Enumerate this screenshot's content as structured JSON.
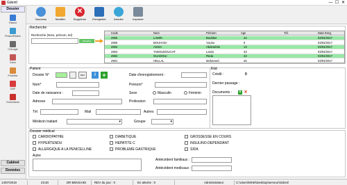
{
  "window": {
    "title": "Gdentl",
    "controls": [
      "—",
      "☐",
      "✕"
    ]
  },
  "sidebar": {
    "top_button": "Dossier",
    "items": [
      "Patient",
      "Photos/Radios",
      "Chirurgie",
      "Soins",
      "Prothèse",
      "ODF",
      "Ordonnance"
    ],
    "bottom_buttons": [
      "Cabinet",
      "Données"
    ]
  },
  "toolbar": {
    "buttons": [
      "Nouveau",
      "Modifier",
      "Supprimer",
      "Enregistrer",
      "Annuler",
      "Imprimer"
    ]
  },
  "search": {
    "section_title": "Recherche",
    "label": "Recherche (Nom, prénom, tel)",
    "value": "",
    "hint": "[illegible]",
    "table": {
      "columns": [
        "Code",
        "Nom",
        "Prénom",
        "Age",
        "Tél.",
        "Date Enrg."
      ],
      "rows": [
        [
          "2906",
          "LAMRI",
          "Boubker",
          "44",
          "",
          "03/04/2017"
        ],
        [
          "2905",
          "BOUHADI",
          "Yacine",
          "8",
          "",
          "03/04/2017"
        ],
        [
          "2904",
          "AISSA",
          "Abderahim",
          "13",
          "",
          "03/04/2017"
        ],
        [
          "2903",
          "TABOUDOUCHT",
          "Lamia",
          "33",
          "",
          "03/04/2017"
        ],
        [
          "2902",
          "GUADOUI",
          "Reda",
          "43",
          "",
          "03/04/2017"
        ],
        [
          "2901",
          "HELLAL",
          "Mohamed",
          "26",
          "",
          "03/04/2017"
        ]
      ]
    }
  },
  "patient": {
    "section_title": "Patient",
    "dossier_label": "Dossier N°",
    "dossier_value": "",
    "date_enreg_label": "Date d'enregistrement :",
    "nom_label": "Nom*",
    "prenom_label": "Prénom*",
    "naissance_label": "Date de naissance :",
    "sexe_label": "Sexe",
    "sexe_options": [
      "Masculin",
      "Féminin"
    ],
    "adresse_label": "Adresse",
    "profession_label": "Profession",
    "tel_label": "Tél",
    "mail_label": "Mail",
    "autres_label": "Autres",
    "medecin_label": "Médecin traitant",
    "groupe_label": "Groupe"
  },
  "etat": {
    "section_title": "Etat",
    "credit_label": "Crédit :",
    "credit_value": "0",
    "dernier_passage_label": "Dernier passage :",
    "documents_label": "Documents :"
  },
  "medical": {
    "section_title": "Dossier médical",
    "conditions": [
      "CARDIOPATHIE",
      "DIABETIQUE",
      "GROSSESSE EN COURS",
      "HYPERTENDU",
      "HEPATITE C",
      "INSULINO-DEPENDANT",
      "ALLERGIQUE A LA PENICELLINE",
      "PROBLEME GASTRIQUE",
      "SIDA"
    ],
    "autre_label": "Autre",
    "antecedent_familiaux_label": "Antécédent familiaux :",
    "antecedent_medicaux_label": "Antécédent medicaux :"
  },
  "statusbar": {
    "date": "14/07/2019",
    "time": "23:40",
    "doctor": "DR BENSAIDI",
    "rdv": "RDV du jour : 0",
    "attente": "En attente : 0",
    "user": "Administrateur",
    "path": "C:\\Users\\MHD\\Desktop\\serveur\\Gdentl"
  },
  "colors": {
    "row_highlight": "#98e8a6",
    "row_plain": "#ffffff",
    "accent_green": "#44b347",
    "hint_bg": "#62c466"
  }
}
